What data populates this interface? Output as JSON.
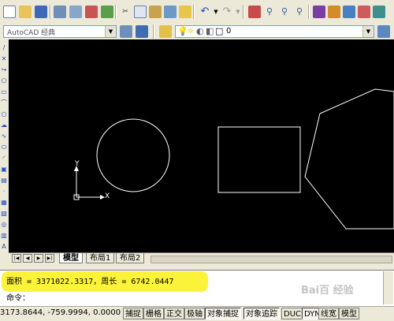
{
  "toolbar": {
    "workspace": "AutoCAD 经典",
    "layer_value": "0"
  },
  "canvas": {
    "ucs_x_label": "X",
    "ucs_y_label": "Y"
  },
  "layout_tabs": [
    "模型",
    "布局1",
    "布局2"
  ],
  "command_history": [
    "面积 = 3371022.3317，周长 = 6742.0447"
  ],
  "command_prompt": "命令：",
  "status": {
    "coordinates": "3173.8644,  -759.9994, 0.0000",
    "toggles": [
      "捕捉",
      "栅格",
      "正交",
      "极轴",
      "对象捕捉",
      "对象追踪",
      "DUCS",
      "DYN",
      "线宽",
      "模型"
    ]
  },
  "watermark": "Bai百 经验"
}
